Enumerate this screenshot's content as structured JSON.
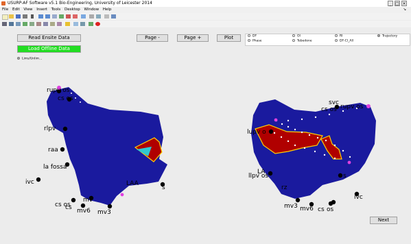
{
  "window": {
    "title": "USURP-AF Software v5.1   Bio-Engineering, University of Leicester  2014"
  },
  "menu": [
    "File",
    "Edit",
    "View",
    "Insert",
    "Tools",
    "Desktop",
    "Window",
    "Help"
  ],
  "buttons": {
    "read_ensite": "Read Ensite Data",
    "load_offline": "Load Offline Data",
    "page_minus": "Page -",
    "page_plus": "Page +",
    "plot": "Plot",
    "next": "Next"
  },
  "checkbox": {
    "lims_label": "Lims/Unlim..."
  },
  "radios": {
    "df": "DF",
    "phase": "Phase",
    "oi": "OI",
    "tebedone": "Tebedone",
    "ri": "RI",
    "df_ci_all": "DF-CI_All",
    "trajectory": "Trajectory"
  },
  "left_map": {
    "labels": [
      "rupv os",
      "cs os",
      "rlpv",
      "raa",
      "la fossa",
      "ivc",
      "LAA",
      "s",
      "cs os",
      "mv6",
      "mv",
      "mv3",
      "cs"
    ]
  },
  "right_map": {
    "labels": [
      "svc",
      "cs os",
      "rupv os",
      "lupv o",
      "LA",
      "llpv os",
      "rz",
      "s",
      "ivc",
      "mv3",
      "mv6",
      "cs",
      "os"
    ]
  },
  "colors": {
    "map_blue": "#1a1a9e",
    "activation_red": "#b00000",
    "electrode": "#000000",
    "marker": "#e040e0",
    "run_button": "#22dd22"
  }
}
